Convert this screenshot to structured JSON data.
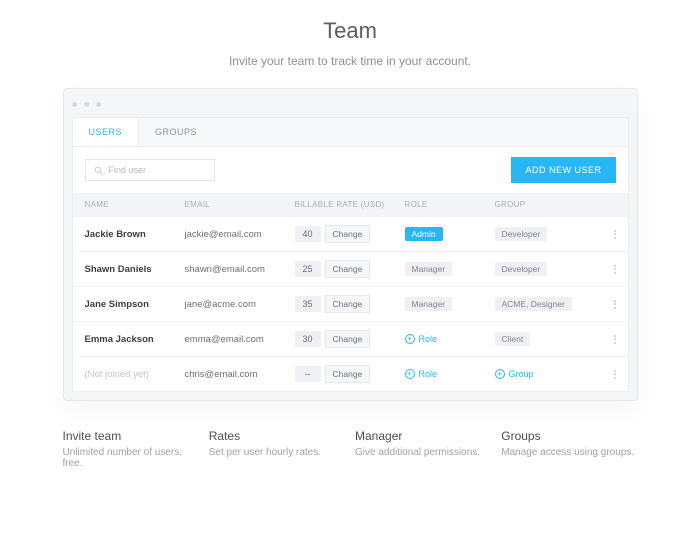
{
  "header": {
    "title": "Team",
    "subtitle": "Invite your team to track time in your account."
  },
  "tabs": {
    "users": "USERS",
    "groups": "GROUPS"
  },
  "search": {
    "placeholder": "Find user"
  },
  "addButton": "ADD NEW USER",
  "columns": {
    "name": "NAME",
    "email": "EMAIL",
    "rate": "BILLABLE RATE (USD)",
    "role": "ROLE",
    "group": "GROUP"
  },
  "changeLabel": "Change",
  "roleLinkLabel": "Role",
  "groupLinkLabel": "Group",
  "rows": [
    {
      "name": "Jackie Brown",
      "email": "jackie@email.com",
      "rate": "40",
      "roleType": "admin",
      "roleLabel": "Admin",
      "groupType": "tag",
      "groupLabel": "Developer"
    },
    {
      "name": "Shawn Daniels",
      "email": "shawn@email.com",
      "rate": "25",
      "roleType": "manager",
      "roleLabel": "Manager",
      "groupType": "tag",
      "groupLabel": "Developer"
    },
    {
      "name": "Jane Simpson",
      "email": "jane@acme.com",
      "rate": "35",
      "roleType": "manager",
      "roleLabel": "Manager",
      "groupType": "tag",
      "groupLabel": "ACME, Designer"
    },
    {
      "name": "Emma Jackson",
      "email": "emma@email.com",
      "rate": "30",
      "roleType": "add",
      "roleLabel": "Role",
      "groupType": "tag",
      "groupLabel": "Client"
    },
    {
      "name": "(Not joined yet)",
      "email": "chris@email.com",
      "rate": "--",
      "roleType": "add",
      "roleLabel": "Role",
      "groupType": "add",
      "groupLabel": "Group",
      "faded": true
    }
  ],
  "features": [
    {
      "title": "Invite team",
      "desc": "Unlimited number of users, free."
    },
    {
      "title": "Rates",
      "desc": "Set per user hourly rates."
    },
    {
      "title": "Manager",
      "desc": "Give additional permissions."
    },
    {
      "title": "Groups",
      "desc": "Manage access using groups."
    }
  ]
}
